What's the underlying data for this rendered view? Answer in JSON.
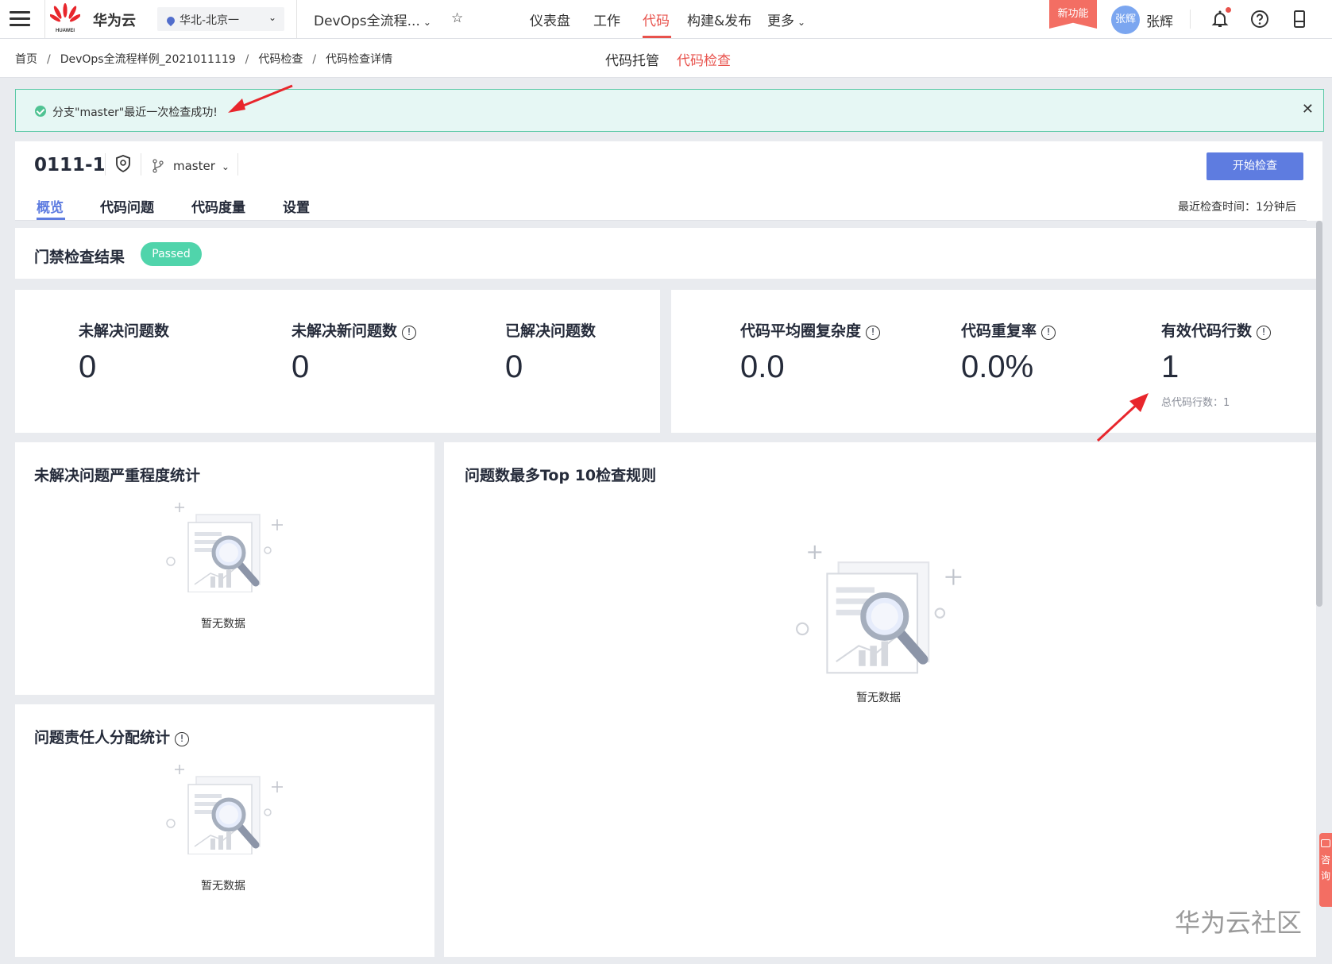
{
  "topbar": {
    "brand": "华为云",
    "logo_text": "HUAWEI",
    "region": "华北-北京一",
    "project": "DevOps全流程...",
    "nav": [
      "仪表盘",
      "工作",
      "代码",
      "构建&发布",
      "更多"
    ],
    "new_feature": "新功能",
    "avatar_text": "张辉",
    "username": "张辉"
  },
  "breadcrumb": [
    "首页",
    "DevOps全流程样例_2021011119",
    "代码检查",
    "代码检查详情"
  ],
  "subtabs": [
    "代码托管",
    "代码检查"
  ],
  "alert": {
    "message": "分支\"master\"最近一次检查成功!"
  },
  "repo": {
    "name": "0111-1",
    "branch": "master",
    "start_button": "开始检查",
    "tabs": [
      "概览",
      "代码问题",
      "代码度量",
      "设置"
    ],
    "last_check": "最近检查时间：1分钟后"
  },
  "gate": {
    "title": "门禁检查结果",
    "status": "Passed"
  },
  "metrics": [
    {
      "label": "未解决问题数",
      "value": "0"
    },
    {
      "label": "未解决新问题数",
      "value": "0"
    },
    {
      "label": "已解决问题数",
      "value": "0"
    },
    {
      "label": "代码平均圈复杂度",
      "value": "0.0"
    },
    {
      "label": "代码重复率",
      "value": "0.0%"
    },
    {
      "label": "有效代码行数",
      "value": "1"
    }
  ],
  "total_lines": "总代码行数：1",
  "sections": {
    "severity": "未解决问题严重程度统计",
    "top10": "问题数最多Top 10检查规则",
    "owner": "问题责任人分配统计"
  },
  "empty_text": "暂无数据",
  "consult": "咨询",
  "watermark": "华为云社区",
  "colors": {
    "accent": "#5e7ce0",
    "brand_red": "#e8524c",
    "passed": "#50d4ab"
  }
}
